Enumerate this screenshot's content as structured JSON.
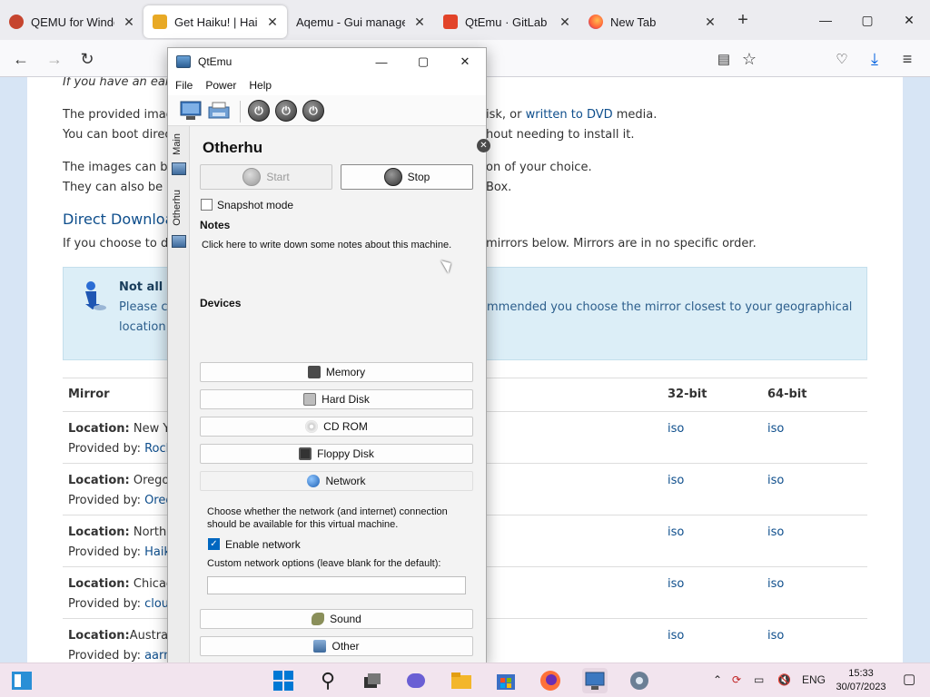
{
  "browser": {
    "tabs": [
      {
        "label": "QEMU for Windows – Insta",
        "active": false
      },
      {
        "label": "Get Haiku! | Haiku Proje",
        "active": true
      },
      {
        "label": "Aqemu - Gui management",
        "active": false
      },
      {
        "label": "QtEmu · GitLab",
        "active": false
      },
      {
        "label": "New Tab",
        "active": false
      }
    ],
    "new_tab": "+",
    "window_controls": {
      "minimize": "—",
      "maximize": "▢",
      "close": "✕"
    }
  },
  "page": {
    "intro_italic": "If you have an earlie",
    "p1_a": "The provided imag",
    "p1_b": "isk, or ",
    "p1_link": "written to DVD",
    "p1_c": " media.",
    "p2_a": "You can boot direc",
    "p2_b": "hout needing to install it.",
    "p3_a": "The images can be",
    "p3_b": "on of your choice.",
    "p4_a": "They can also be us",
    "p4_b": "Box.",
    "heading": "Direct Downloa",
    "p5_a": "If you choose to do",
    "p5_b": "mirrors below. Mirrors are in no specific order.",
    "info_bold": "Not all m",
    "info_l1a": "Please ch",
    "info_l1b": "mmended you choose the mirror closest to your geographical",
    "info_l2": "location.",
    "table_headers": {
      "mirror": "Mirror",
      "b32": "32-bit",
      "b64": "64-bit"
    },
    "rows": [
      {
        "loc_label": "Location:",
        "loc": " New Yo",
        "prov_label": "Provided by: ",
        "prov": "Roch",
        "b32": "iso",
        "b64": "iso"
      },
      {
        "loc_label": "Location:",
        "loc": " Oregon",
        "prov_label": "Provided by: ",
        "prov": "Oreg",
        "b32": "iso",
        "b64": "iso"
      },
      {
        "loc_label": "Location:",
        "loc": " North V",
        "prov_label": "Provided by: ",
        "prov": "Haiku",
        "b32": "iso",
        "b64": "iso"
      },
      {
        "loc_label": "Location:",
        "loc": " Chicago",
        "prov_label": "Provided by: ",
        "prov": "cloud",
        "b32": "iso",
        "b64": "iso"
      },
      {
        "loc_label": "Location:",
        "loc": "Australi",
        "prov_label": "Provided by: ",
        "prov": "aarne",
        "b32": "iso",
        "b64": "iso"
      }
    ]
  },
  "qtemu": {
    "title": "QtEmu",
    "menu": [
      "File",
      "Power",
      "Help"
    ],
    "side_tabs": [
      "Main",
      "Otherhu"
    ],
    "vm_name": "Otherhu",
    "close_glyph": "✕",
    "start_label": "Start",
    "stop_label": "Stop",
    "snapshot_label": "Snapshot mode",
    "snapshot_checked": false,
    "notes_title": "Notes",
    "notes_placeholder": "Click here to write down some notes about this machine.",
    "devices_title": "Devices",
    "devices": [
      "Memory",
      "Hard Disk",
      "CD ROM",
      "Floppy Disk",
      "Network"
    ],
    "network_text": "Choose whether the network (and internet) connection should be available for this virtual machine.",
    "enable_network_label": "Enable network",
    "enable_network_checked": true,
    "custom_options_label": "Custom network options (leave blank for the default):",
    "custom_options_value": "",
    "sound_label": "Sound",
    "other_label": "Other"
  },
  "taskbar": {
    "language": "ENG",
    "time": "15:33",
    "date": "30/07/2023"
  },
  "colors": {
    "link": "#0e4e8c",
    "taskbar": "#f2e4ee",
    "info_bg": "#dceef7",
    "checkbox_on": "#0067c0"
  }
}
